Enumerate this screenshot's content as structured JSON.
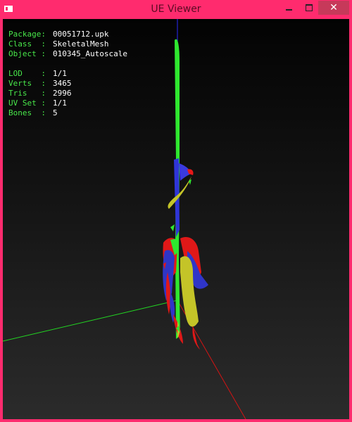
{
  "window": {
    "title": "UE Viewer",
    "icon": "app-window-icon",
    "controls": {
      "minimize_icon": "minimize-icon",
      "maximize_icon": "maximize-icon",
      "close_glyph": "✕"
    },
    "frame_color": "#ff2b6e",
    "close_button_color": "#c7395a"
  },
  "info": {
    "package": {
      "label": "Package:",
      "value": "00051712.upk"
    },
    "class": {
      "label": "Class  :",
      "value": "SkeletalMesh"
    },
    "object": {
      "label": "Object :",
      "value": "010345_Autoscale"
    },
    "lod": {
      "label": "LOD    :",
      "value": "1/1"
    },
    "verts": {
      "label": "Verts  :",
      "value": "3465"
    },
    "tris": {
      "label": "Tris   :",
      "value": "2996"
    },
    "uvset": {
      "label": "UV Set :",
      "value": "1/1"
    },
    "bones": {
      "label": "Bones  :",
      "value": "5"
    }
  },
  "viewport": {
    "background_top": "#030303",
    "background_bottom": "#2b2b2b",
    "axis_colors": {
      "x": "#ff1a1a",
      "y": "#2dff2d",
      "z": "#3a3aff"
    },
    "mesh_colors": [
      "#2dff2d",
      "#ff1a1a",
      "#3a3aff",
      "#c8c832"
    ]
  }
}
